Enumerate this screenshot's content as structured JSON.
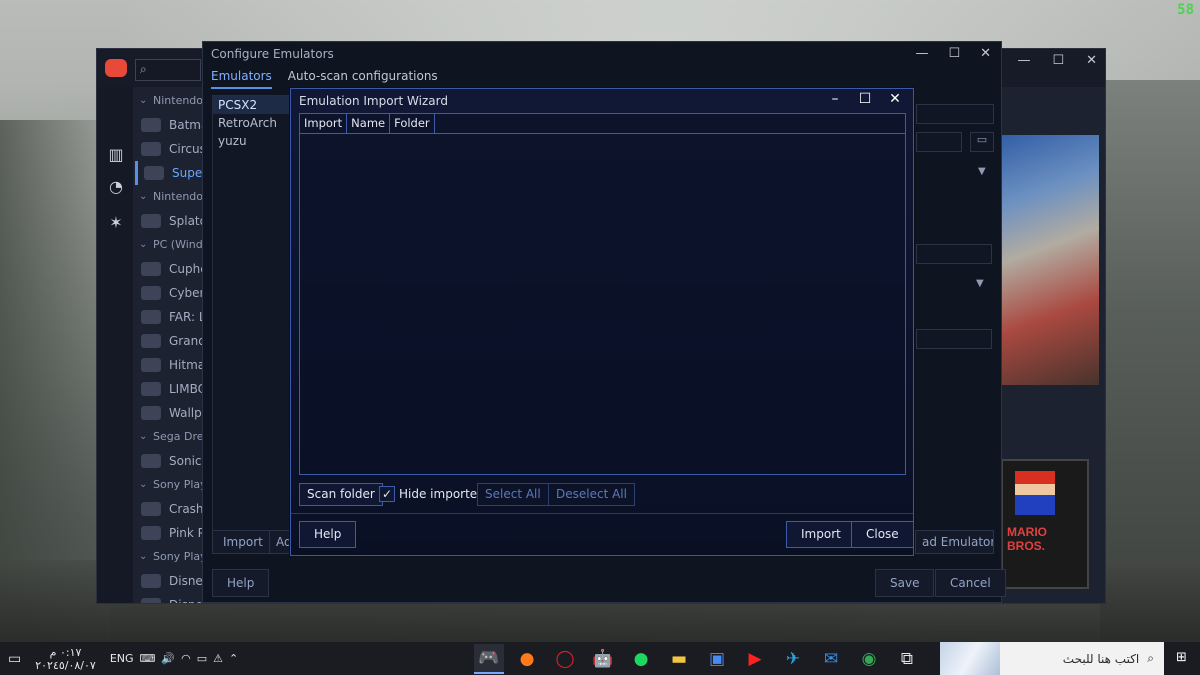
{
  "overlay": {
    "fps": "58"
  },
  "playnite": {
    "library_rows": [
      {
        "type": "group",
        "label": "Nintendo"
      },
      {
        "type": "game",
        "label": "Batma"
      },
      {
        "type": "game",
        "label": "Circus"
      },
      {
        "type": "game",
        "label": "Super",
        "selected": true
      },
      {
        "type": "group",
        "label": "Nintendo"
      },
      {
        "type": "game",
        "label": "Splato"
      },
      {
        "type": "group",
        "label": "PC (Wind"
      },
      {
        "type": "game",
        "label": "Cuphe"
      },
      {
        "type": "game",
        "label": "Cyberp"
      },
      {
        "type": "game",
        "label": "FAR: Lo"
      },
      {
        "type": "game",
        "label": "Grand"
      },
      {
        "type": "game",
        "label": "Hitman"
      },
      {
        "type": "game",
        "label": "LIMBO"
      },
      {
        "type": "game",
        "label": "Wallpa"
      },
      {
        "type": "group",
        "label": "Sega Drea"
      },
      {
        "type": "game",
        "label": "Sonic A"
      },
      {
        "type": "group",
        "label": "Sony Play"
      },
      {
        "type": "game",
        "label": "Crash"
      },
      {
        "type": "game",
        "label": "Pink Pa"
      },
      {
        "type": "group",
        "label": "Sony Play"
      },
      {
        "type": "game",
        "label": "Disney"
      },
      {
        "type": "game",
        "label": "Disney"
      }
    ],
    "cover_title": "MARIO BROS."
  },
  "configure": {
    "title": "Configure Emulators",
    "tabs": [
      "Emulators",
      "Auto-scan configurations"
    ],
    "emulators": [
      "PCSX2",
      "RetroArch",
      "yuzu"
    ],
    "import_label": "Import",
    "add_label": "Ad",
    "download_label": "ad Emulators...",
    "help_label": "Help",
    "save_label": "Save",
    "cancel_label": "Cancel"
  },
  "wizard": {
    "title": "Emulation Import Wizard",
    "columns": [
      "Import",
      "Name",
      "Folder"
    ],
    "scan_folder_label": "Scan folder",
    "hide_imported_label": "Hide imported",
    "hide_imported_checked": true,
    "select_all_label": "Select All",
    "deselect_all_label": "Deselect All",
    "help_label": "Help",
    "import_label": "Import",
    "close_label": "Close"
  },
  "taskbar": {
    "language": "ENG",
    "time": "٠:١٧ م",
    "date": "٢٠٢٤٥/٠٨/٠٧",
    "search_placeholder": "اكتب هنا للبحث"
  }
}
